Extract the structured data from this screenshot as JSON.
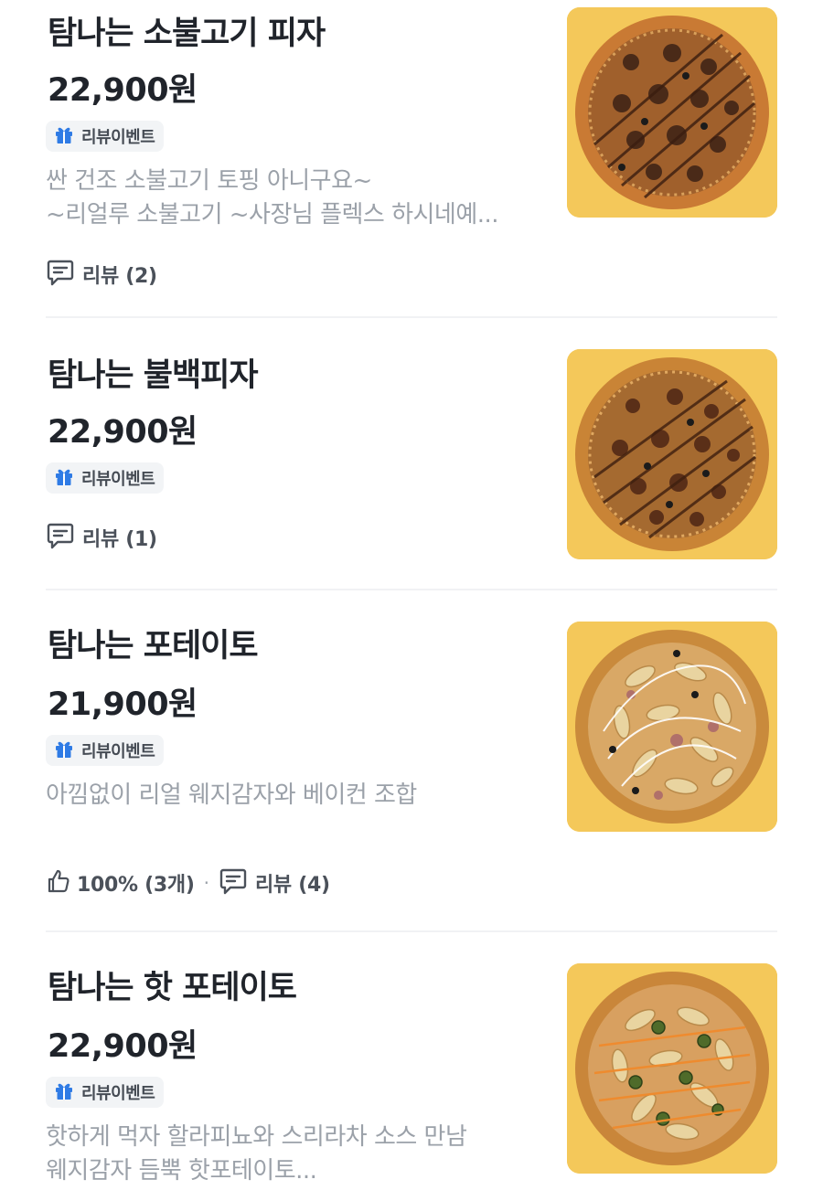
{
  "menu_items": [
    {
      "title": "탐나는 소불고기 피자",
      "price": "22,900원",
      "badge": "리뷰이벤트",
      "description_lines": [
        "싼 건조 소불고기 토핑 아니구요~",
        "~리얼루 소불고기 ~사장님 플렉스 하시네예..."
      ],
      "review_label": "리뷰 (2)",
      "image_icon": "pizza-bulgogi-photo"
    },
    {
      "title": "탐나는 불백피자",
      "price": "22,900원",
      "badge": "리뷰이벤트",
      "description_lines": [],
      "review_label": "리뷰 (1)",
      "image_icon": "pizza-bulbaek-photo"
    },
    {
      "title": "탐나는 포테이토",
      "price": "21,900원",
      "badge": "리뷰이벤트",
      "description_lines": [
        "아낌없이 리얼 웨지감자와 베이컨 조합"
      ],
      "like_label": "100% (3개)",
      "review_label": "리뷰 (4)",
      "image_icon": "pizza-potato-photo"
    },
    {
      "title": "탐나는 핫 포테이토",
      "price": "22,900원",
      "badge": "리뷰이벤트",
      "description_lines": [
        "핫하게 먹자 할라피뇨와 스리라차 소스 만남",
        "웨지감자 듬뿍 핫포테이토..."
      ],
      "image_icon": "pizza-hot-potato-photo"
    }
  ],
  "meta_separator": "·",
  "colors": {
    "badge_gift_icon": "#2f7be5",
    "thumbnail_background": "#f4c85a",
    "title_text": "#20242b",
    "description_text": "#9ba1a9"
  }
}
